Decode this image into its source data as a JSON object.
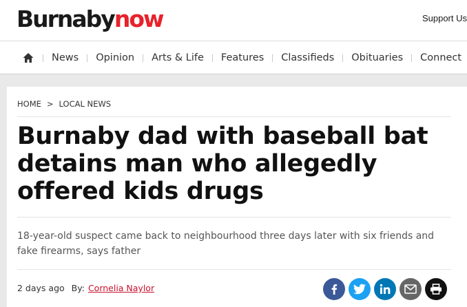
{
  "header": {
    "logo_part1": "Burnaby",
    "logo_part2": "now",
    "support_label": "Support Us",
    "brand_color": "#e8222b"
  },
  "nav": {
    "home_icon": "home-icon",
    "items": [
      "News",
      "Opinion",
      "Arts & Life",
      "Features",
      "Classifieds",
      "Obituaries",
      "Connect"
    ]
  },
  "breadcrumb": {
    "home": "HOME",
    "separator": ">",
    "section": "LOCAL NEWS"
  },
  "article": {
    "title": "Burnaby dad with baseball bat detains man who allegedly offered kids drugs",
    "subtitle": "18-year-old suspect came back to neighbourhood three days later with six friends and fake firearms, says father",
    "timestamp": "2 days ago",
    "by_label": "By:",
    "author": "Cornelia Naylor",
    "author_color": "#c8102e"
  },
  "share": {
    "buttons": [
      {
        "icon": "facebook-icon",
        "color": "#3b5998"
      },
      {
        "icon": "twitter-icon",
        "color": "#1da1f2"
      },
      {
        "icon": "linkedin-icon",
        "color": "#0077b5"
      },
      {
        "icon": "email-icon",
        "color": "#666666"
      },
      {
        "icon": "print-icon",
        "color": "#111111"
      }
    ]
  }
}
